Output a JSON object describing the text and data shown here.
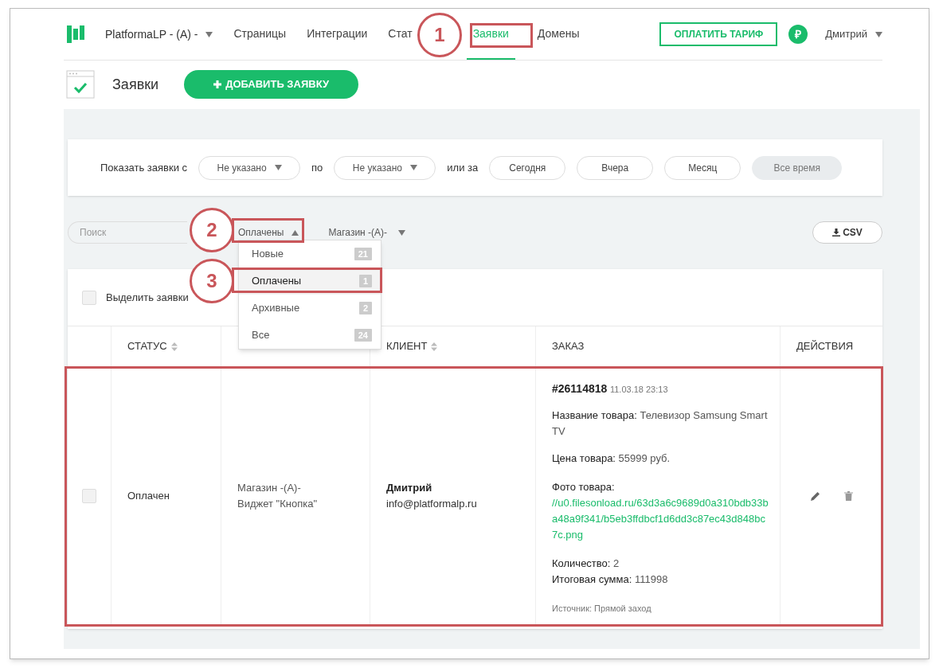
{
  "header": {
    "brand": "PlatformaLP - (A) -",
    "nav": [
      {
        "label": "Страницы",
        "selected": false
      },
      {
        "label": "Интеграции",
        "selected": false
      },
      {
        "label": "Стат",
        "selected": false
      },
      {
        "label": "Заявки",
        "selected": true
      },
      {
        "label": "Домены",
        "selected": false
      }
    ],
    "pay_button": "ОПЛАТИТЬ ТАРИФ",
    "currency": "₽",
    "user": "Дмитрий"
  },
  "page": {
    "title": "Заявки",
    "add_button": "ДОБАВИТЬ ЗАЯВКУ"
  },
  "date_filter": {
    "label": "Показать заявки с",
    "from": "Не указано",
    "to_label": "по",
    "to": "Не указано",
    "or_label": "или за",
    "periods": [
      {
        "label": "Сегодня",
        "selected": false
      },
      {
        "label": "Вчера",
        "selected": false
      },
      {
        "label": "Месяц",
        "selected": false
      },
      {
        "label": "Все время",
        "selected": true
      }
    ]
  },
  "search": {
    "placeholder": "Поиск"
  },
  "status_filter": {
    "value": "Оплачены",
    "expanded": true,
    "options": [
      {
        "label": "Новые",
        "count": "21",
        "selected": false
      },
      {
        "label": "Оплачены",
        "count": "1",
        "selected": true
      },
      {
        "label": "Архивные",
        "count": "2",
        "selected": false
      },
      {
        "label": "Все",
        "count": "24",
        "selected": false
      }
    ]
  },
  "shop_filter": "Магазин -(A)-",
  "csv_button": "CSV",
  "select_all": {
    "label": "Выделить заявки",
    "checked": false
  },
  "table": {
    "columns": {
      "status": "СТАТУС",
      "client": "КЛИЕНТ",
      "order": "ЗАКАЗ",
      "actions": "ДЕЙСТВИЯ"
    },
    "rows": [
      {
        "checked": false,
        "status": "Оплачен",
        "page": [
          "Магазин -(A)-",
          "Виджет \"Кнопка\""
        ],
        "client_name": "Дмитрий",
        "client_email": "info@platformalp.ru",
        "order": {
          "number": "#26114818",
          "date": "11.03.18 23:13",
          "fields": [
            {
              "kind": "text",
              "label": "Название товара:",
              "value": "Телевизор Samsung Smart TV"
            },
            {
              "kind": "text",
              "label": "Цена товара:",
              "value": "55999 руб."
            },
            {
              "kind": "link",
              "label": "Фото товара:",
              "value": "//u0.filesonload.ru/63d3a6c9689d0a310bdb33ba48a9f341/b5eb3ffdbcf1d6dd3c87ec43d848bc7c.png"
            }
          ],
          "totals": [
            {
              "label": "Количество:",
              "value": "2"
            },
            {
              "label": "Итоговая сумма:",
              "value": "111998"
            }
          ],
          "source": "Источник: Прямой заход"
        }
      }
    ]
  },
  "annotations": [
    {
      "number": "1"
    },
    {
      "number": "2"
    },
    {
      "number": "3"
    }
  ]
}
